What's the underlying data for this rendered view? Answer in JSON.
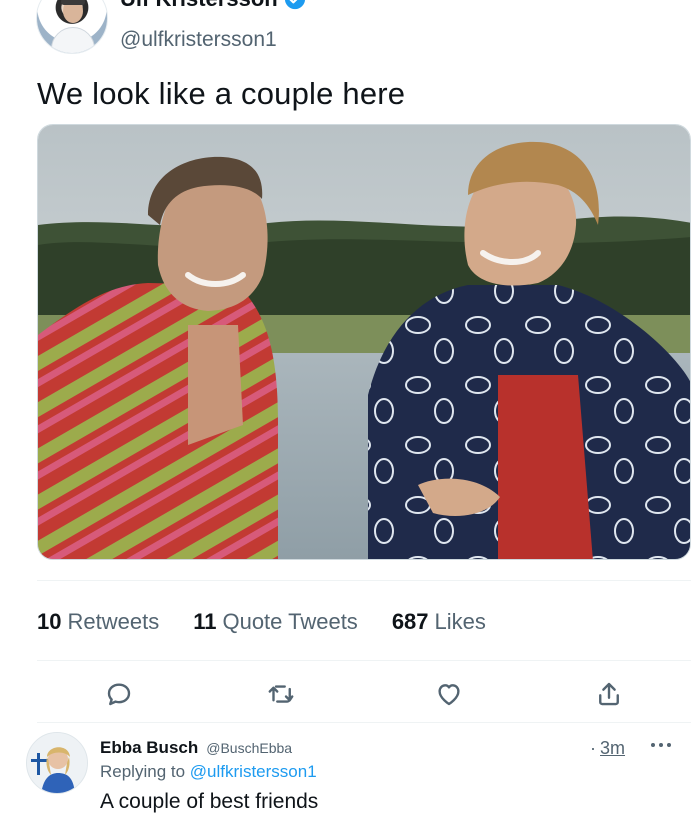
{
  "tweet": {
    "author_name": "Ulf Kristersson",
    "author_handle": "@ulfkristersson1",
    "text": "We look like a couple here",
    "stats": [
      {
        "count": "10",
        "label": "Retweets"
      },
      {
        "count": "11",
        "label": "Quote Tweets"
      },
      {
        "count": "687",
        "label": "Likes"
      }
    ],
    "actions": [
      "reply-icon",
      "retweet-icon",
      "like-icon",
      "share-icon"
    ],
    "verified_icon": "verified-badge-icon",
    "more_icon": "chevron-down-icon"
  },
  "reply": {
    "author_name": "Ebba Busch",
    "author_handle": "@BuschEbba",
    "time_separator": "·",
    "time": "3m",
    "replying_prefix": "Replying to",
    "replying_handle": "@ulfkristersson1",
    "text": "A couple of best friends",
    "more_icon": "more-dots-icon"
  },
  "colors": {
    "text_primary": "#0f1419",
    "text_secondary": "#536471",
    "accent": "#1d9bf0",
    "divider": "#eff3f4"
  }
}
